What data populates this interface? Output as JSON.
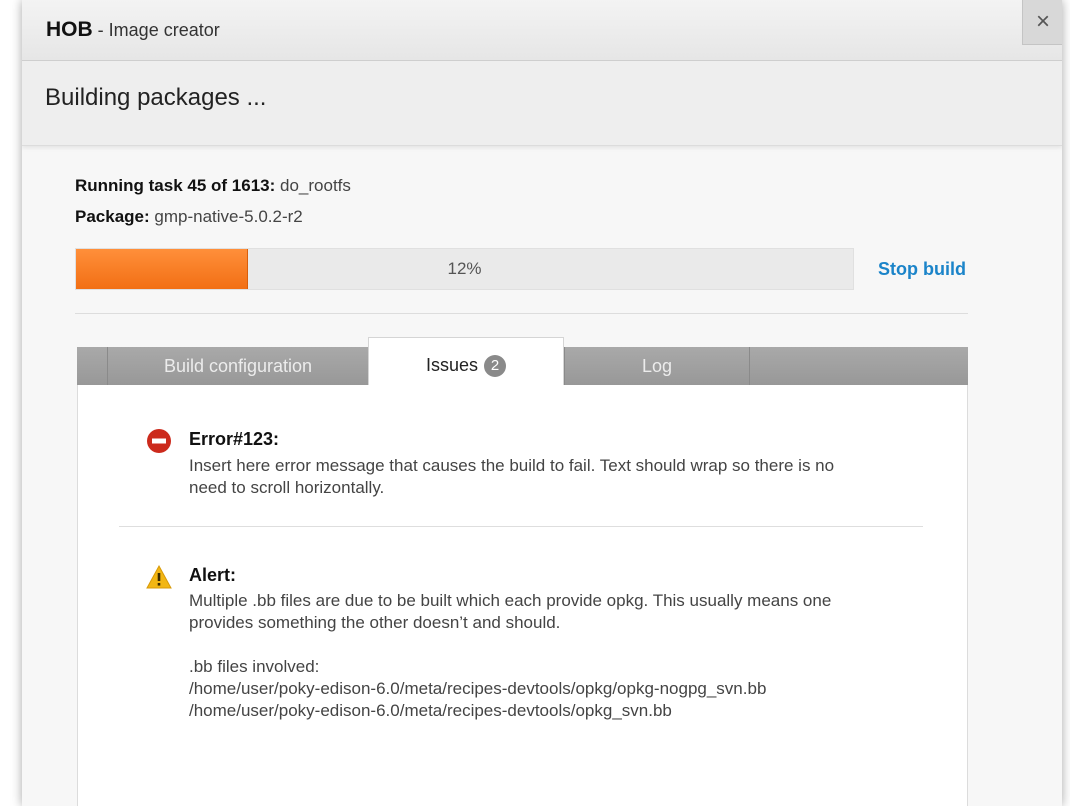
{
  "window": {
    "app_name": "HOB",
    "separator": " - ",
    "app_subtitle": "Image creator",
    "close_label": "×"
  },
  "header": {
    "title": "Building packages ..."
  },
  "build": {
    "task_label": "Running task 45 of 1613:",
    "task_name": "do_rootfs",
    "package_label": "Package:",
    "package_name": "gmp-native-5.0.2-r2",
    "progress_percent": 12,
    "progress_text": "12%",
    "stop_label": "Stop build"
  },
  "tabs": [
    {
      "label": "Build configuration",
      "active": false
    },
    {
      "label": "Issues",
      "badge": "2",
      "active": true
    },
    {
      "label": "Log",
      "active": false
    }
  ],
  "issues": [
    {
      "type": "error",
      "icon": "error-icon",
      "color": "#cc2a1c",
      "title": "Error#123:",
      "lines": [
        "Insert here error message that causes the build to fail. Text should wrap so there is no",
        "need to scroll horizontally."
      ]
    },
    {
      "type": "alert",
      "icon": "warning-icon",
      "color": "#f2b614",
      "title": "Alert:",
      "lines": [
        "Multiple .bb files are due to be built which each provide opkg. This usually means one",
        "provides something the other doesn’t and should.",
        "",
        ".bb files involved:",
        "/home/user/poky-edison-6.0/meta/recipes-devtools/opkg/opkg-nogpg_svn.bb",
        "/home/user/poky-edison-6.0/meta/recipes-devtools/opkg_svn.bb"
      ]
    }
  ],
  "colors": {
    "accent": "#1b84c9",
    "progress": "#f47a1f"
  }
}
